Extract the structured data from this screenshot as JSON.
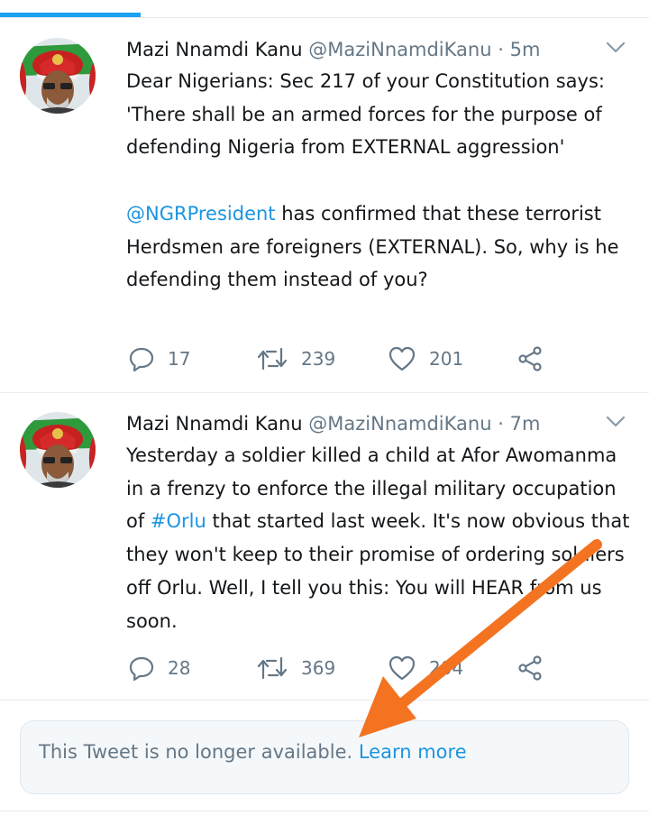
{
  "colors": {
    "accent": "#1da1f2",
    "link": "#1b95e0",
    "secondary_text": "#657786",
    "annotation_arrow": "#f47321"
  },
  "tweets": [
    {
      "author": "Mazi Nnamdi Kanu",
      "handle": "@MaziNnamdiKanu",
      "separator": "·",
      "time": "5m",
      "paragraphs": [
        [
          {
            "text": "Dear Nigerians: Sec 217 of your Constitution says: 'There shall be an armed forces for the purpose of defending Nigeria from EXTERNAL aggression'",
            "link": false
          }
        ],
        [
          {
            "text": "@NGRPresident",
            "link": true
          },
          {
            "text": " has confirmed that these terrorist Herdsmen are foreigners (EXTERNAL). So, why is he defending them instead of you?",
            "link": false
          }
        ]
      ],
      "reply_count": "17",
      "retweet_count": "239",
      "like_count": "201"
    },
    {
      "author": "Mazi Nnamdi Kanu",
      "handle": "@MaziNnamdiKanu",
      "separator": "·",
      "time": "7m",
      "paragraphs": [
        [
          {
            "text": "Yesterday a soldier killed a child at Afor Awomanma in a frenzy to enforce the illegal military occupation of ",
            "link": false
          },
          {
            "text": "#Orlu",
            "link": true
          },
          {
            "text": " that started last week. It's now obvious that they won't keep to their promise of ordering soldiers off Orlu. Well, I tell you this: You will HEAR from us soon.",
            "link": false
          }
        ]
      ],
      "reply_count": "28",
      "retweet_count": "369",
      "like_count": "204"
    }
  ],
  "unavailable_notice": {
    "message": "This Tweet is no longer available. ",
    "learn_more": "Learn more"
  }
}
